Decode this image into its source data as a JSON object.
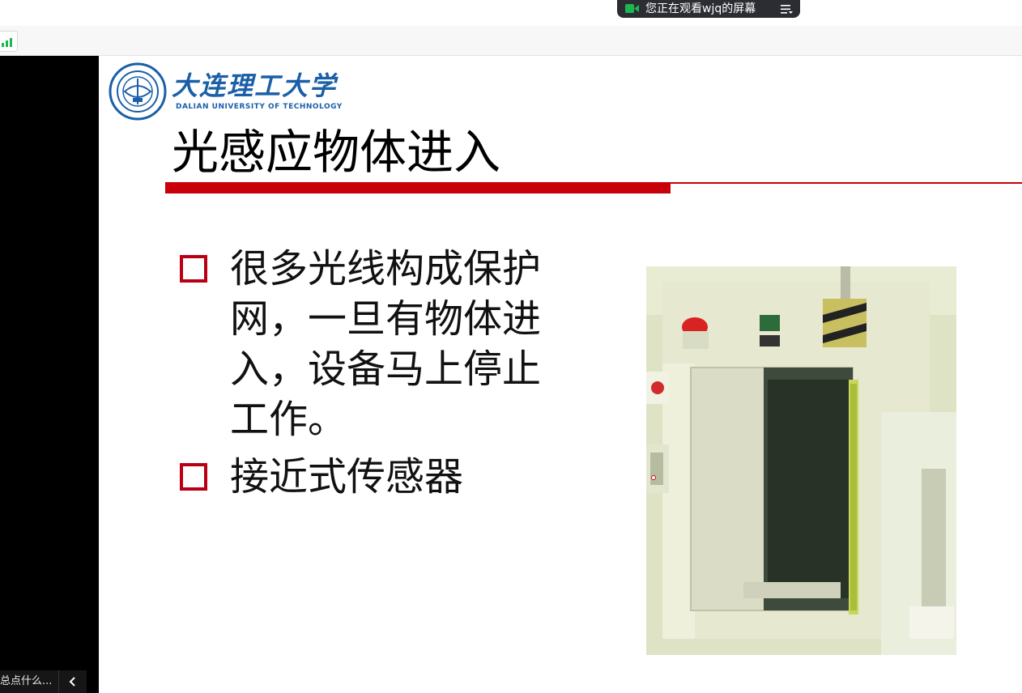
{
  "sharing_banner": {
    "text": "您正在观看wjq的屏幕",
    "camera_icon": "camera-icon",
    "menu_icon": "menu-icon",
    "accent_color": "#1fb651"
  },
  "toolbar": {
    "signal_icon": "signal-strength-icon"
  },
  "left_panel": {
    "caption": "总点什么...",
    "collapse_icon": "chevron-left-icon"
  },
  "slide": {
    "logo": {
      "cn": "大连理工大学",
      "en": "DALIAN UNIVERSITY OF TECHNOLOGY"
    },
    "title": "光感应物体进入",
    "accent_color": "#c8000a",
    "bullets": [
      {
        "lines": [
          "很多光线构成保护",
          "网，一旦有物体进",
          "入，设备马上停止",
          "工作。"
        ]
      },
      {
        "lines": [
          "接近式传感器"
        ]
      }
    ],
    "photo_icon": "machine-photo"
  }
}
